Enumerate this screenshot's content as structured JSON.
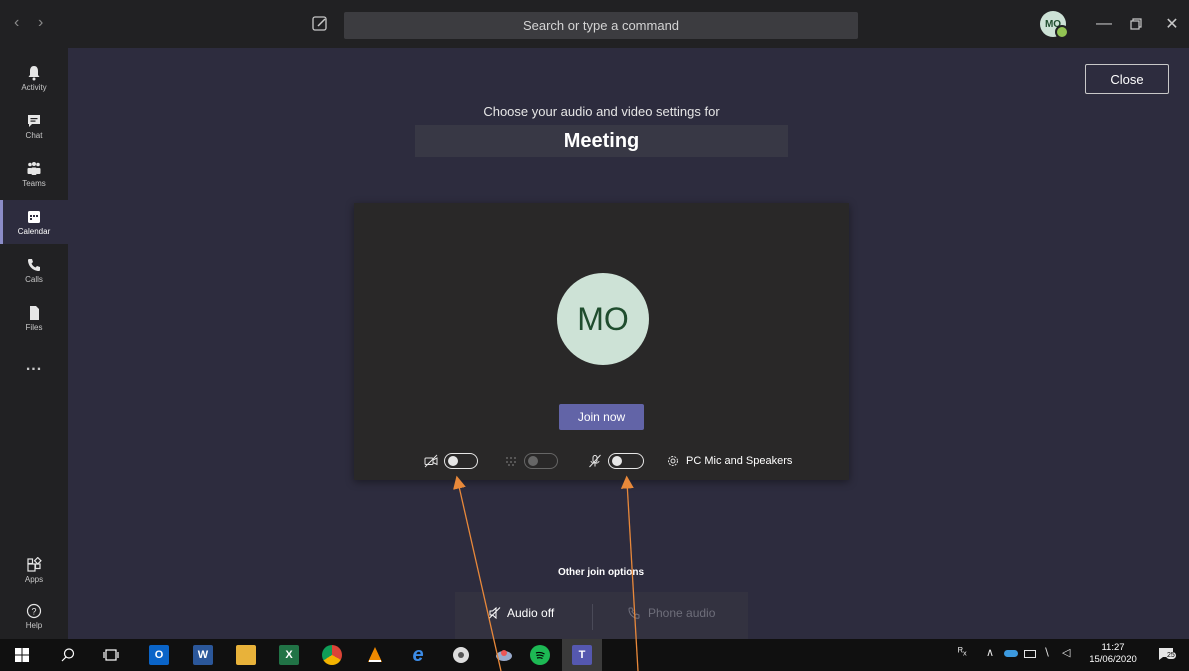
{
  "titlebar": {
    "search_placeholder": "Search or type a command",
    "avatar_initials": "MO",
    "back_icon": "chevron-left-icon",
    "forward_icon": "chevron-right-icon"
  },
  "rail": {
    "items": [
      {
        "label": "Activity",
        "icon": "bell-icon"
      },
      {
        "label": "Chat",
        "icon": "chat-icon"
      },
      {
        "label": "Teams",
        "icon": "teams-icon"
      },
      {
        "label": "Calendar",
        "icon": "calendar-icon",
        "active": true
      },
      {
        "label": "Calls",
        "icon": "phone-icon"
      },
      {
        "label": "Files",
        "icon": "file-icon"
      },
      {
        "label": "...",
        "icon": "more-icon"
      }
    ],
    "bottom": [
      {
        "label": "Apps",
        "icon": "apps-icon"
      },
      {
        "label": "Help",
        "icon": "help-icon"
      }
    ]
  },
  "main": {
    "close_label": "Close",
    "choose_text": "Choose your audio and video settings for",
    "meeting_title": "Meeting",
    "avatar_initials": "MO",
    "join_label": "Join now",
    "device_label": "PC Mic and Speakers",
    "other_options_title": "Other join options",
    "audio_off_label": "Audio off",
    "phone_audio_label": "Phone audio"
  },
  "taskbar": {
    "time": "11:27",
    "date": "15/06/2020",
    "notification_count": "25"
  },
  "colors": {
    "accent": "#6264a7",
    "background": "#2d2c3e",
    "rail": "#212123",
    "annotation_arrow": "#e8883a"
  }
}
